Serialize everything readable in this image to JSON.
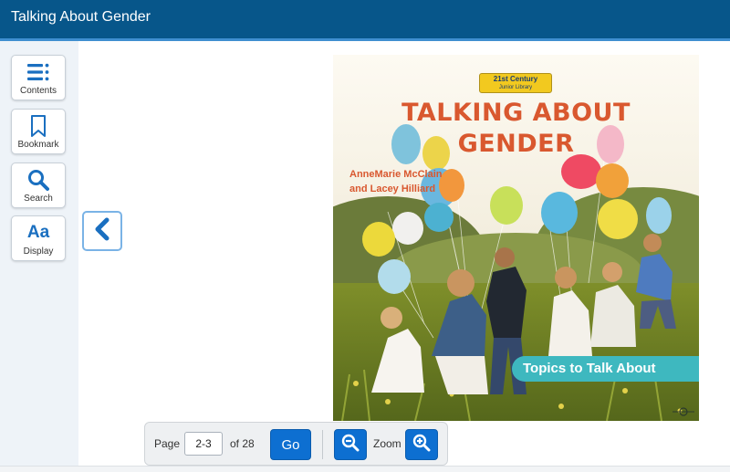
{
  "app": {
    "title": "Talking About Gender"
  },
  "sidebar": {
    "items": [
      {
        "label": "Contents",
        "icon": "contents-list-icon"
      },
      {
        "label": "Bookmark",
        "icon": "bookmark-icon"
      },
      {
        "label": "Search",
        "icon": "search-icon"
      },
      {
        "label": "Display",
        "icon": "display-text-icon",
        "glyph": "Aa"
      }
    ]
  },
  "viewer": {
    "prev_icon": "chevron-left-icon",
    "cover": {
      "series_line1": "21st Century",
      "series_line2": "Junior Library",
      "title_line1": "TALKING ABOUT",
      "title_line2": "GENDER",
      "author_line1": "AnneMarie McClain",
      "author_line2": "and Lacey Hilliard",
      "ribbon": "Topics to Talk About"
    }
  },
  "pager": {
    "page_label": "Page",
    "page_value": "2-3",
    "of_label": "of 28",
    "go_label": "Go",
    "zoom_label": "Zoom",
    "zoom_out_icon": "zoom-out-icon",
    "zoom_in_icon": "zoom-in-icon"
  },
  "colors": {
    "header": "#07568a",
    "accent": "#0d6fd1",
    "cover_title": "#d9582f",
    "ribbon": "#3eb8bf"
  }
}
